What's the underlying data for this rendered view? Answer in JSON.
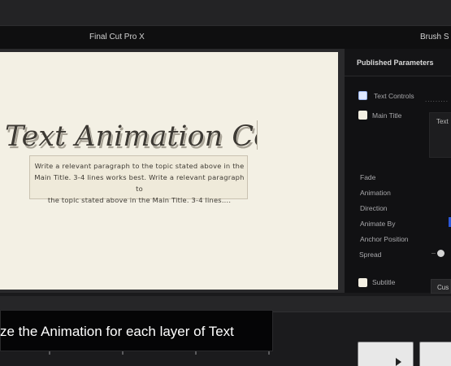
{
  "window": {
    "app_title": "Final Cut Pro X",
    "secondary_title": "Brush S"
  },
  "viewer": {
    "headline": "Text Animation Controls",
    "paragraph_lines": [
      "Write a relevant paragraph to the topic stated above in the",
      "Main Title. 3-4 lines works best. Write a relevant paragraph to",
      "the topic stated above in the Main Title. 3-4 lines...."
    ]
  },
  "inspector": {
    "title": "Published Parameters",
    "sections": [
      {
        "label": "Text Controls"
      },
      {
        "label": "Main Title"
      },
      {
        "label": "Subtitle"
      }
    ],
    "main_title_value": "Text",
    "parameters": [
      {
        "label": "Fade"
      },
      {
        "label": "Animation"
      },
      {
        "label": "Direction"
      },
      {
        "label": "Animate By"
      },
      {
        "label": "Anchor Position"
      },
      {
        "label": "Spread"
      }
    ],
    "subtitle_value": "Cus"
  },
  "overlay": {
    "caption": "ze the Animation for each layer of Text"
  },
  "icons": {
    "text_controls": "checkbox-icon",
    "main_title": "note-icon",
    "subtitle": "note-icon",
    "thumb_play": "play-triangle-icon"
  },
  "colors": {
    "viewer_background": "#f3f0e4",
    "app_background": "#1a1a1c",
    "accent_blue": "#2b58d8"
  }
}
